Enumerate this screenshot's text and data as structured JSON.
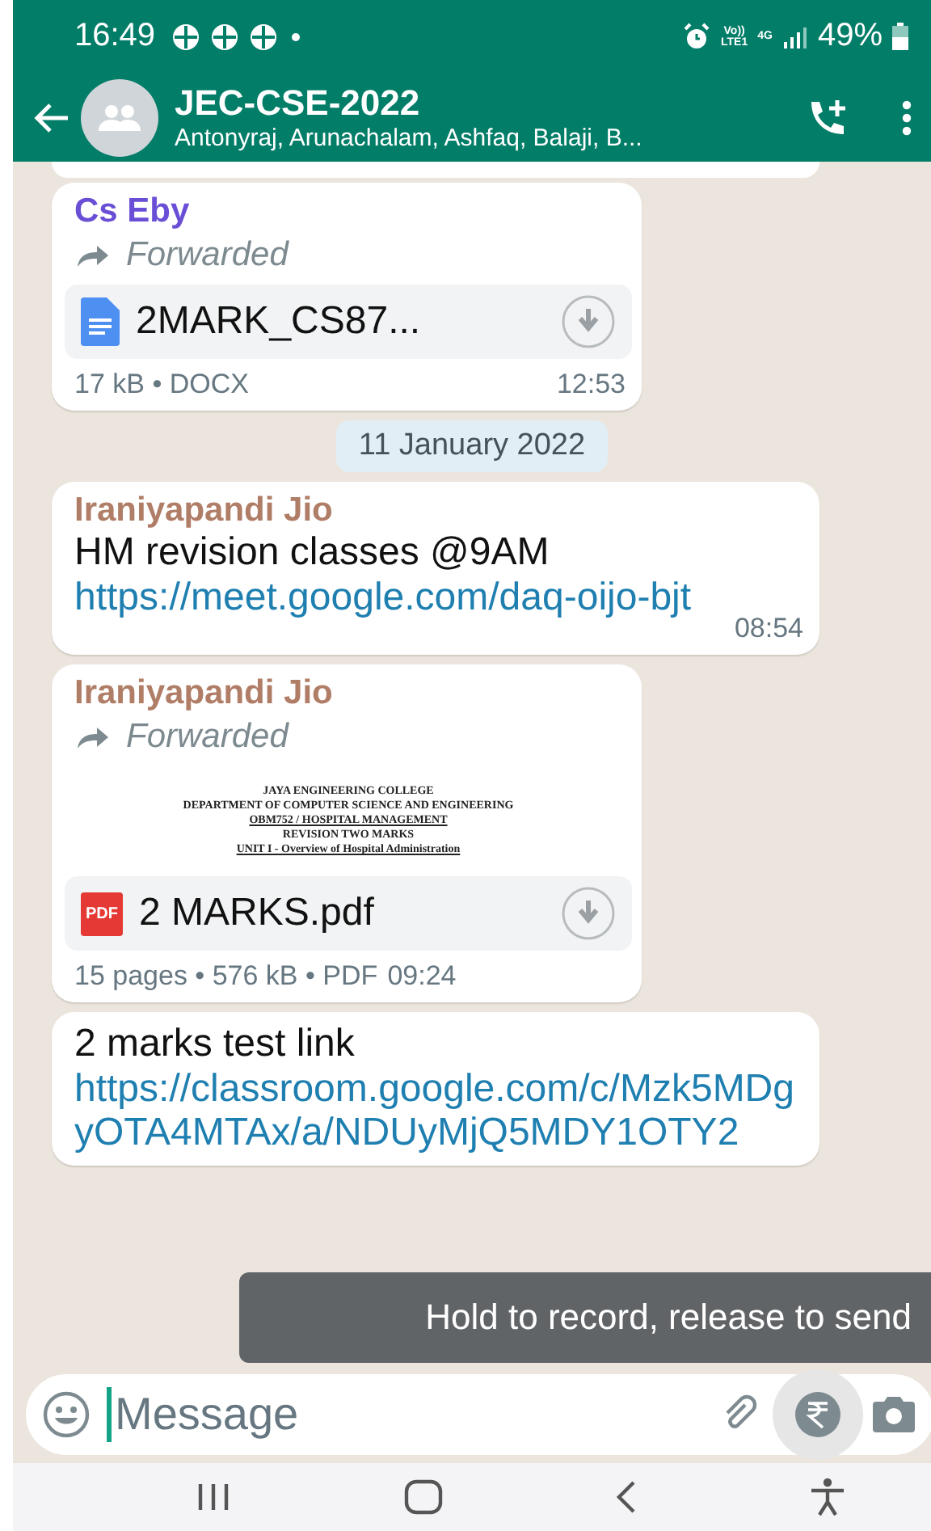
{
  "status_bar": {
    "time": "16:49",
    "network_labels": [
      "Vo))",
      "LTE1",
      "4G"
    ],
    "battery": "49%"
  },
  "header": {
    "title": "JEC-CSE-2022",
    "subtitle": "Antonyraj, Arunachalam, Ashfaq, Balaji, B..."
  },
  "messages": [
    {
      "kind": "document",
      "sender": "Cs Eby",
      "color": "#6a4fd6",
      "forwarded": "Forwarded",
      "file_name": "2MARK_CS87...",
      "meta": "17 kB • DOCX",
      "time": "12:53"
    },
    {
      "kind": "date",
      "text": "11 January 2022"
    },
    {
      "kind": "text",
      "sender": "Iraniyapandi Jio",
      "color": "#b07d66",
      "text": "HM revision classes @9AM",
      "link": "https://meet.google.com/daq-oijo-bjt",
      "time": "08:54"
    },
    {
      "kind": "pdf",
      "sender": "Iraniyapandi Jio",
      "color": "#b07d66",
      "forwarded": "Forwarded",
      "preview_lines": [
        "JAYA ENGINEERING COLLEGE",
        "DEPARTMENT OF COMPUTER SCIENCE AND ENGINEERING",
        "OBM752 / HOSPITAL MANAGEMENT",
        "REVISION TWO MARKS",
        "UNIT I - Overview of Hospital Administration"
      ],
      "file_name": "2 MARKS.pdf",
      "file_badge": "PDF",
      "meta": "15 pages • 576 kB • PDF",
      "time": "09:24"
    },
    {
      "kind": "text",
      "text": "2 marks test link",
      "link": "https://classroom.google.com/c/Mzk5MDgyOTA4MTAx/a/NDUyMjQ5MDY1OTY2"
    }
  ],
  "tooltip": "Hold to record, release to send",
  "composer": {
    "placeholder": "Message"
  }
}
